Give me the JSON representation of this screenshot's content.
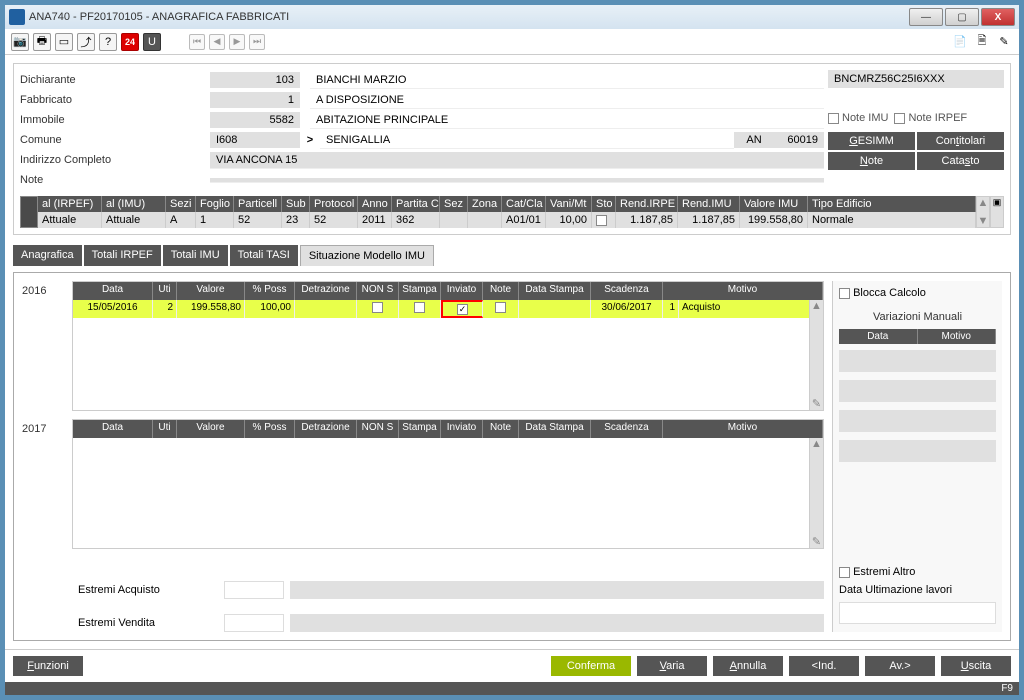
{
  "window_title": "ANA740 - PF20170105 - ANAGRAFICA FABBRICATI",
  "toolbar": {
    "badge24": "24"
  },
  "form": {
    "labels": {
      "dichiarante": "Dichiarante",
      "fabbricato": "Fabbricato",
      "immobile": "Immobile",
      "comune": "Comune",
      "indirizzo": "Indirizzo Completo",
      "note": "Note"
    },
    "dichiarante_id": "103",
    "dichiarante_nome": "BIANCHI MARZIO",
    "fabbricato_id": "1",
    "fabbricato_desc": "A DISPOSIZIONE",
    "immobile_id": "5582",
    "immobile_desc": "ABITAZIONE PRINCIPALE",
    "comune_code": "I608",
    "comune_nome": "SENIGALLIA",
    "prov": "AN",
    "cap": "60019",
    "indirizzo": "VIA ANCONA 15",
    "codice_fiscale": "BNCMRZ56C25I6XXX",
    "note_imu": "Note IMU",
    "note_irpef": "Note IRPEF"
  },
  "side_buttons": {
    "gesimm": "GESIMM",
    "contitolari": "Contitolari",
    "note": "Note",
    "catasto": "Catasto"
  },
  "grid": {
    "headers": [
      "al (IRPEF)",
      "al (IMU)",
      "Sezi",
      "Foglio",
      "Particell",
      "Sub",
      "Protocol",
      "Anno",
      "Partita C",
      "Sez",
      "Zona",
      "Cat/Cla",
      "Vani/Mt",
      "Sto",
      "Rend.IRPE",
      "Rend.IMU",
      "Valore IMU",
      "Tipo Edificio"
    ],
    "row": [
      "Attuale",
      "Attuale",
      "A",
      "1",
      "52",
      "23",
      "52",
      "2011",
      "362",
      "",
      "",
      "A01/01",
      "10,00",
      "",
      "1.187,85",
      "1.187,85",
      "199.558,80",
      "Normale"
    ]
  },
  "tabs": [
    "Anagrafica",
    "Totali IRPEF",
    "Totali IMU",
    "Totali TASI",
    "Situazione Modello IMU"
  ],
  "active_tab": "Situazione Modello IMU",
  "years": {
    "y2016": "2016",
    "y2017": "2017",
    "headers": [
      "Data",
      "Uti",
      "Valore",
      "% Poss",
      "Detrazione",
      "NON S",
      "Stampa",
      "Inviato",
      "Note",
      "Data Stampa",
      "Scadenza",
      "Motivo"
    ],
    "row2016": {
      "data": "15/05/2016",
      "uti": "2",
      "valore": "199.558,80",
      "poss": "100,00",
      "scadenza": "30/06/2017",
      "n": "1",
      "motivo": "Acquisto"
    }
  },
  "bottom": {
    "acquisto": "Estremi Acquisto",
    "vendita": "Estremi Vendita"
  },
  "rightcol": {
    "blocca": "Blocca Calcolo",
    "variazioni": "Variazioni Manuali",
    "data": "Data",
    "motivo": "Motivo",
    "estremi_altro": "Estremi Altro",
    "data_ult": "Data Ultimazione lavori"
  },
  "footer": {
    "funzioni": "Funzioni",
    "conferma": "Conferma",
    "varia": "Varia",
    "annulla": "Annulla",
    "ind": "<Ind.",
    "av": "Av.>",
    "uscita": "Uscita"
  },
  "status": "F9"
}
